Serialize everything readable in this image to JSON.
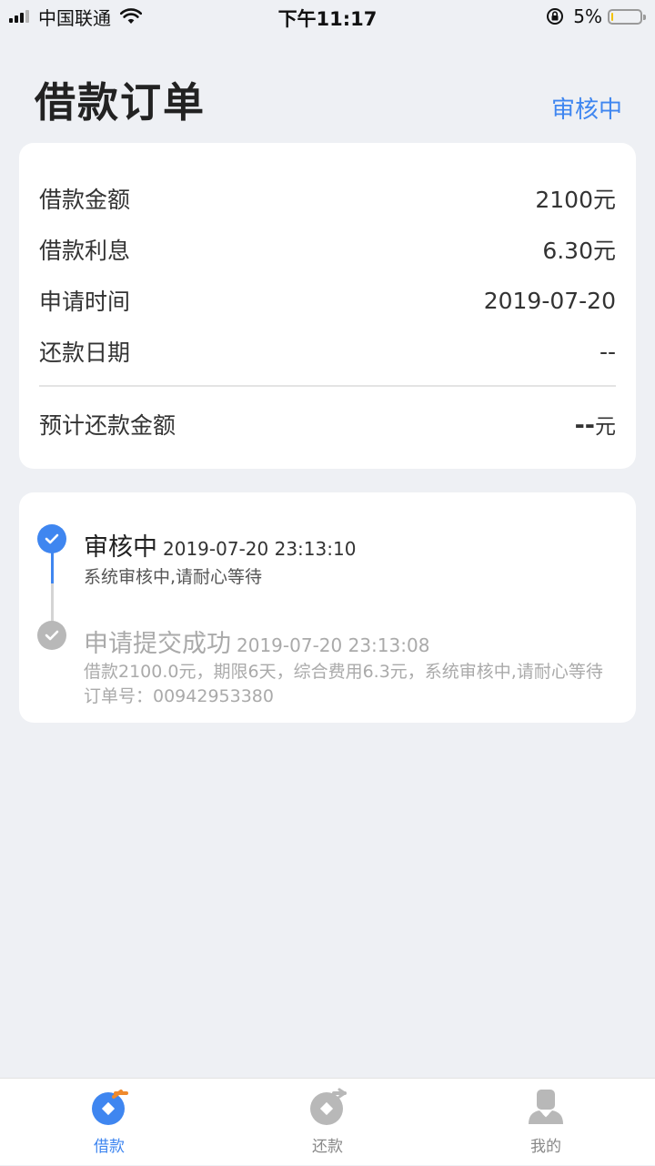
{
  "status_bar": {
    "carrier": "中国联通",
    "time": "下午11:17",
    "battery_percent": "5%",
    "battery_level": 0.05
  },
  "header": {
    "title": "借款订单",
    "status": "审核中"
  },
  "summary": {
    "rows": [
      {
        "label": "借款金额",
        "value": "2100元"
      },
      {
        "label": "借款利息",
        "value": "6.30元"
      },
      {
        "label": "申请时间",
        "value": "2019-07-20"
      },
      {
        "label": "还款日期",
        "value": "--"
      }
    ],
    "total": {
      "label": "预计还款金额",
      "value": "--",
      "unit": "元"
    }
  },
  "timeline": [
    {
      "title": "审核中",
      "timestamp": "2019-07-20 23:13:10",
      "description": "系统审核中,请耐心等待"
    },
    {
      "title": "申请提交成功",
      "timestamp": "2019-07-20 23:13:08",
      "description": "借款2100.0元，期限6天，综合费用6.3元，系统审核中,请耐心等待 订单号：00942953380"
    }
  ],
  "tabs": [
    {
      "label": "借款",
      "icon": "loan-icon"
    },
    {
      "label": "还款",
      "icon": "repay-icon"
    },
    {
      "label": "我的",
      "icon": "profile-icon"
    }
  ],
  "colors": {
    "accent": "#3f86f0",
    "orange": "#f08a2c",
    "inactive": "#b8b8b8",
    "background": "#eef0f4"
  }
}
